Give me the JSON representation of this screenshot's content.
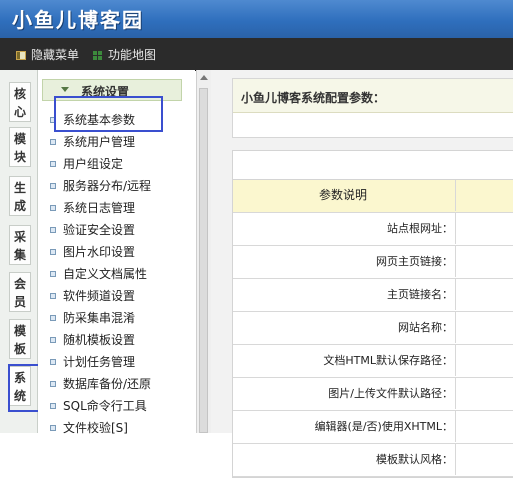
{
  "header": {
    "title": "小鱼儿博客园"
  },
  "toolbar": {
    "hide_menu": "隐藏菜单",
    "sitemap": "功能地图"
  },
  "vtabs": [
    "核心",
    "模块",
    "生成",
    "采集",
    "会员",
    "模板",
    "系统"
  ],
  "menu": {
    "heading": "系统设置",
    "items": [
      "系统基本参数",
      "系统用户管理",
      "用户组设定",
      "服务器分布/远程",
      "系统日志管理",
      "验证安全设置",
      "图片水印设置",
      "自定义文档属性",
      "软件频道设置",
      "防采集串混淆",
      "随机模板设置",
      "计划任务管理",
      "数据库备份/还原",
      "SQL命令行工具",
      "文件校验[S]"
    ]
  },
  "main": {
    "config_title": "小鱼儿博客系统配置参数：",
    "table_header": "参数说明",
    "rows": [
      "站点根网址：",
      "网页主页链接：",
      "主页链接名：",
      "网站名称：",
      "文档HTML默认保存路径：",
      "图片/上传文件默认路径：",
      "编辑器(是/否)使用XHTML：",
      "模板默认风格："
    ]
  },
  "colors": {
    "header_blue": "#2f6fbd",
    "toolbar_dark": "#2b2b2b",
    "highlight": "#3a4fcf",
    "table_header": "#fbf7cf"
  }
}
